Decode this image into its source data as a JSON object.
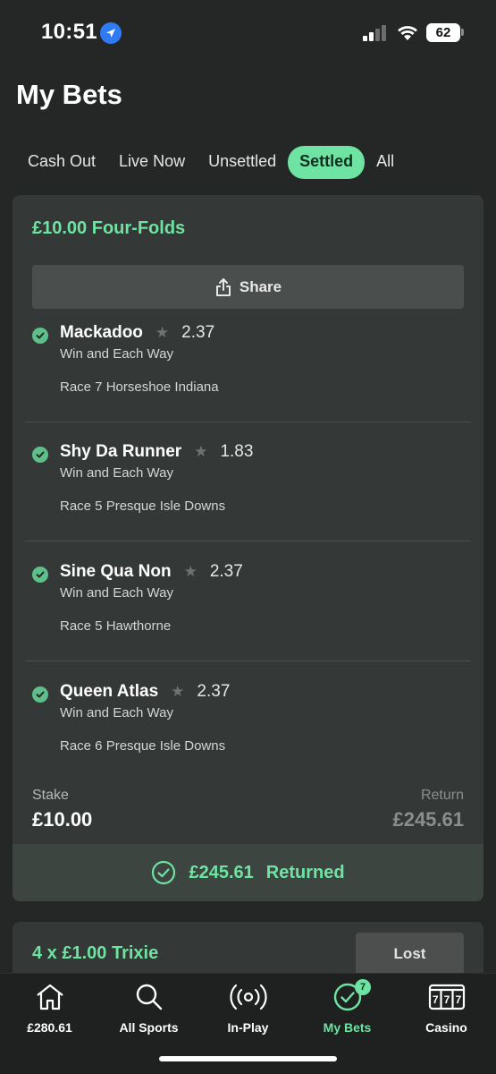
{
  "status_bar": {
    "time": "10:51",
    "battery": "62"
  },
  "page_title": "My Bets",
  "tabs": [
    {
      "label": "Cash Out",
      "active": false
    },
    {
      "label": "Live Now",
      "active": false
    },
    {
      "label": "Unsettled",
      "active": false
    },
    {
      "label": "Settled",
      "active": true
    },
    {
      "label": "All",
      "active": false
    }
  ],
  "bet": {
    "title": "£10.00 Four-Folds",
    "share_label": "Share",
    "selections": [
      {
        "name": "Mackadoo",
        "odds": "2.37",
        "market": "Win and Each Way",
        "race": "Race 7 Horseshoe Indiana"
      },
      {
        "name": "Shy Da Runner",
        "odds": "1.83",
        "market": "Win and Each Way",
        "race": "Race 5 Presque Isle Downs"
      },
      {
        "name": "Sine Qua Non",
        "odds": "2.37",
        "market": "Win and Each Way",
        "race": "Race 5 Hawthorne"
      },
      {
        "name": "Queen Atlas",
        "odds": "2.37",
        "market": "Win and Each Way",
        "race": "Race 6 Presque Isle Downs"
      }
    ],
    "stake_label": "Stake",
    "stake_value": "£10.00",
    "return_label": "Return",
    "return_value": "£245.61",
    "returned_amount": "£245.61",
    "returned_label": "Returned"
  },
  "bet2": {
    "title": "4 x £1.00 Trixie",
    "status": "Lost"
  },
  "nav": [
    {
      "label": "£280.61",
      "icon": "home-icon"
    },
    {
      "label": "All Sports",
      "icon": "search-icon"
    },
    {
      "label": "In-Play",
      "icon": "live-icon"
    },
    {
      "label": "My Bets",
      "icon": "check-circle-icon",
      "badge": "7",
      "active": true
    },
    {
      "label": "Casino",
      "icon": "slot-machine-icon"
    }
  ],
  "colors": {
    "accent": "#6ee3a2",
    "background": "#252726",
    "card": "#343836"
  }
}
